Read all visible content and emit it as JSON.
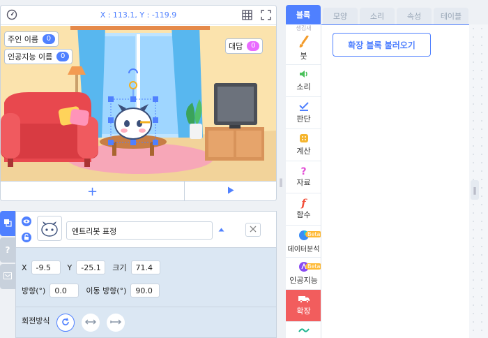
{
  "stage": {
    "coordinates": "X : 113.1, Y : -119.9",
    "add_label": "+",
    "variables": [
      {
        "label": "주인 이름",
        "value": "0"
      },
      {
        "label": "인공지능 이름",
        "value": "0"
      }
    ],
    "answer": {
      "label": "대답",
      "value": "0"
    }
  },
  "object": {
    "name": "엔트리봇 표정",
    "x_label": "X",
    "x_value": "-9.5",
    "y_label": "Y",
    "y_value": "-25.1",
    "size_label": "크기",
    "size_value": "71.4",
    "direction_label": "방향(°)",
    "direction_value": "0.0",
    "move_direction_label": "이동 방향(°)",
    "move_direction_value": "90.0",
    "rotation_label": "회전방식"
  },
  "block_tabs": [
    "블록",
    "모양",
    "소리",
    "속성",
    "테이블"
  ],
  "categories": [
    {
      "label": "붓",
      "icon": "brush-icon"
    },
    {
      "label": "소리",
      "icon": "speaker-icon"
    },
    {
      "label": "판단",
      "icon": "check-icon"
    },
    {
      "label": "계산",
      "icon": "calculator-icon"
    },
    {
      "label": "자료",
      "icon": "question-icon"
    },
    {
      "label": "함수",
      "icon": "function-icon"
    },
    {
      "label": "데이터분석",
      "icon": "pie-chart-icon"
    },
    {
      "label": "인공지능",
      "icon": "ai-icon"
    },
    {
      "label": "확장",
      "icon": "truck-icon"
    }
  ],
  "beta_label": "Beta",
  "top_cut_label": "생김새",
  "ext_button": "확장 블록 불러오기",
  "colors": {
    "accent": "#4f80ff",
    "active_category": "#f25d5d"
  }
}
